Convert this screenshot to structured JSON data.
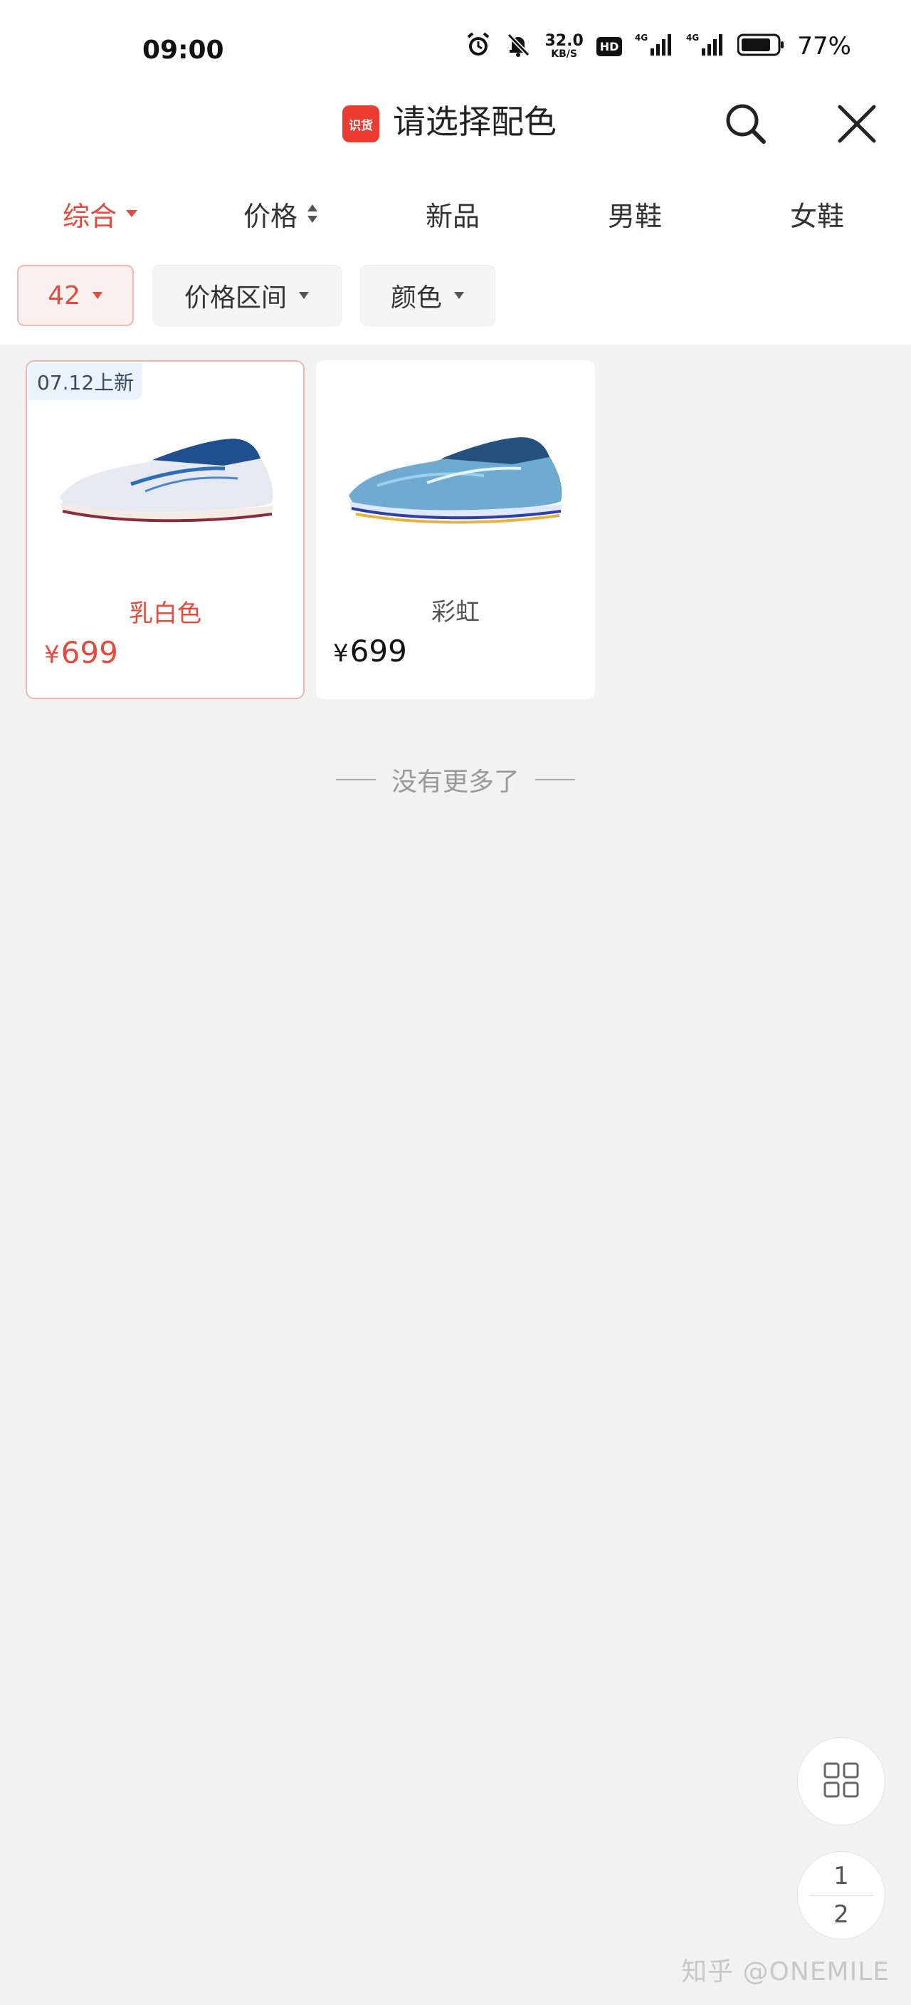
{
  "status_bar": {
    "time": "09:00",
    "net_speed_value": "32.0",
    "net_speed_unit": "KB/S",
    "hd_label": "HD",
    "signal_1_label": "4G",
    "signal_2_label": "4G",
    "battery_percent": "77%",
    "icons": [
      "alarm-icon",
      "mute-bell-icon",
      "hd-icon",
      "signal-icon",
      "signal-icon",
      "battery-icon"
    ]
  },
  "header": {
    "logo_text": "识货",
    "title": "请选择配色",
    "search_icon": "search-icon",
    "close_icon": "close-icon",
    "accent_color": "#ee3b2f"
  },
  "tabs": [
    {
      "label": "综合",
      "active": true,
      "marker": "caret-down-icon"
    },
    {
      "label": "价格",
      "active": false,
      "marker": "sort-updown-icon"
    },
    {
      "label": "新品",
      "active": false
    },
    {
      "label": "男鞋",
      "active": false
    },
    {
      "label": "女鞋",
      "active": false
    }
  ],
  "filters": [
    {
      "label": "42",
      "active": true
    },
    {
      "label": "价格区间",
      "active": false
    },
    {
      "label": "颜色",
      "active": false
    }
  ],
  "products": [
    {
      "tag": "07.12上新",
      "name": "乳白色",
      "price_symbol": "¥",
      "price": "699",
      "selected": true
    },
    {
      "tag": "",
      "name": "彩虹",
      "price_symbol": "¥",
      "price": "699",
      "selected": false
    }
  ],
  "end_notice": "没有更多了",
  "fab": {
    "grid_icon": "grid-view-icon",
    "page_current": "1",
    "page_total": "2"
  },
  "watermark": "知乎 @ONEMILE",
  "colors": {
    "active_red": "#e44a3d",
    "background": "#f2f2f2"
  }
}
